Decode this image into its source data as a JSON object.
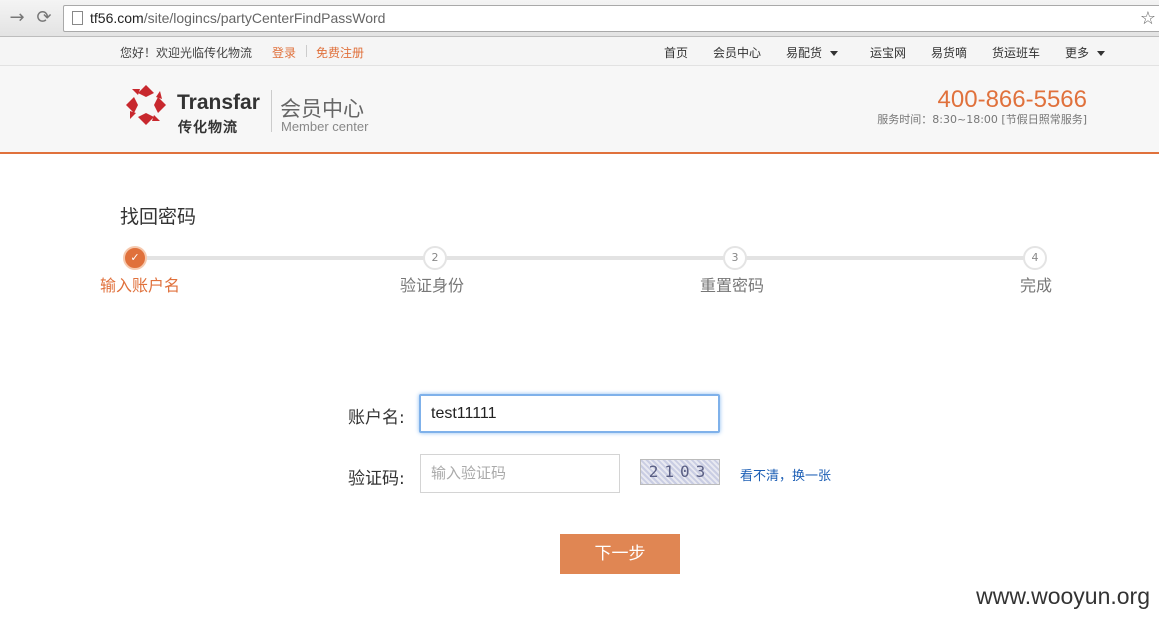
{
  "browser": {
    "url_domain": "tf56.com",
    "url_path": "/site/logincs/partyCenterFindPassWord",
    "back_icon": "back-arrow",
    "reload_icon": "reload",
    "bookmark_icon": "star"
  },
  "topbar": {
    "greeting": "您好！欢迎光临传化物流",
    "login": "登录",
    "register": "免费注册",
    "nav": [
      "首页",
      "会员中心",
      "易配货",
      "运宝网",
      "易货嘀",
      "货运班车",
      "更多"
    ]
  },
  "header": {
    "brand_en": "Transfar",
    "brand_cn": "传化物流",
    "section_cn": "会员中心",
    "section_en": "Member center",
    "phone": "400-866-5566",
    "hours": "服务时间：8:30~18:00 [节假日照常服务]"
  },
  "page": {
    "title": "找回密码",
    "steps": [
      {
        "num": "✓",
        "label": "输入账户名",
        "active": true
      },
      {
        "num": "2",
        "label": "验证身份",
        "active": false
      },
      {
        "num": "3",
        "label": "重置密码",
        "active": false
      },
      {
        "num": "4",
        "label": "完成",
        "active": false
      }
    ]
  },
  "form": {
    "account_label": "账户名:",
    "account_value": "test11111",
    "captcha_label": "验证码:",
    "captcha_placeholder": "输入验证码",
    "captcha_text": "2103",
    "refresh_link": "看不清，换一张",
    "next_button": "下一步"
  },
  "watermark": "www.wooyun.org",
  "colors": {
    "accent": "#e0713c",
    "link": "#1d5fb5",
    "button": "#e08653"
  }
}
